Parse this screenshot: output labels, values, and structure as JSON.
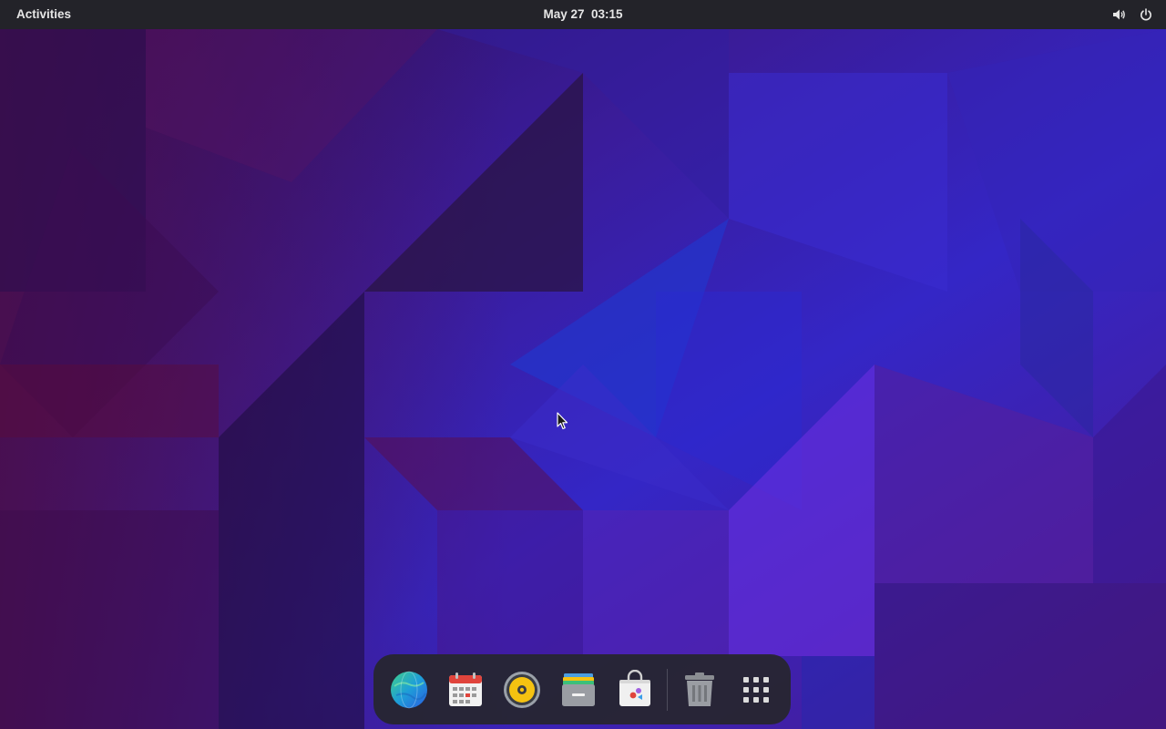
{
  "top_bar": {
    "activities_label": "Activities",
    "clock": "May 27  03:15",
    "tray": {
      "volume_icon": "speaker-volume-icon",
      "power_icon": "power-icon"
    }
  },
  "wallpaper": {
    "style": "low-poly geometric",
    "colors": [
      "#2a1058",
      "#5a1a7a",
      "#3a2ad0",
      "#1e34c8",
      "#6a28c8"
    ]
  },
  "dock": {
    "items": [
      {
        "icon": "web-browser-globe-icon"
      },
      {
        "icon": "calendar-icon"
      },
      {
        "icon": "rhythmbox-music-icon"
      },
      {
        "icon": "files-file-manager-icon"
      },
      {
        "icon": "software-store-icon"
      },
      {
        "icon": "trash-icon"
      },
      {
        "icon": "show-applications-grid-icon"
      }
    ]
  },
  "pointer": {
    "icon": "mouse-pointer-icon"
  }
}
